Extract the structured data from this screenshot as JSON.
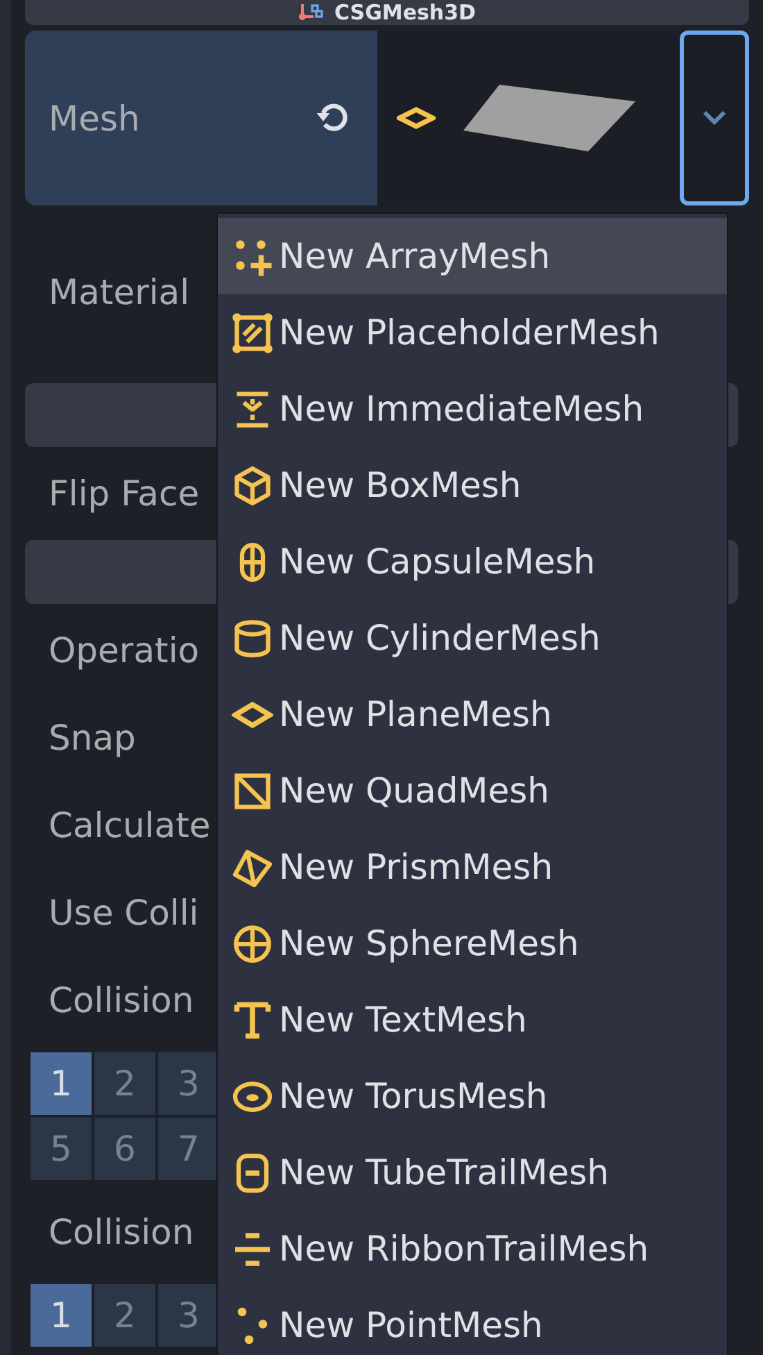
{
  "header": {
    "title": "CSGMesh3D"
  },
  "mesh_row": {
    "label": "Mesh"
  },
  "material_row": {
    "label": "Material"
  },
  "properties": [
    {
      "kind": "section"
    },
    {
      "kind": "label",
      "label": "Flip Face"
    },
    {
      "kind": "section"
    },
    {
      "kind": "label",
      "label": "Operatio"
    },
    {
      "kind": "label",
      "label": "Snap"
    },
    {
      "kind": "label",
      "label": "Calculate"
    },
    {
      "kind": "label",
      "label": "Use Colli"
    },
    {
      "kind": "label",
      "label": "Collision"
    },
    {
      "kind": "grid",
      "cells": [
        {
          "label": "1",
          "selected": true
        },
        {
          "label": "2",
          "selected": false
        },
        {
          "label": "3",
          "selected": false
        },
        {
          "label": "5",
          "selected": false
        },
        {
          "label": "6",
          "selected": false
        },
        {
          "label": "7",
          "selected": false
        }
      ]
    },
    {
      "kind": "label",
      "label": "Collision"
    },
    {
      "kind": "grid",
      "cells": [
        {
          "label": "1",
          "selected": true
        },
        {
          "label": "2",
          "selected": false
        },
        {
          "label": "3",
          "selected": false
        }
      ]
    }
  ],
  "menu": [
    {
      "label": "New ArrayMesh",
      "selected": true
    },
    {
      "label": "New PlaceholderMesh",
      "selected": false
    },
    {
      "label": "New ImmediateMesh",
      "selected": false
    },
    {
      "label": "New BoxMesh",
      "selected": false
    },
    {
      "label": "New CapsuleMesh",
      "selected": false
    },
    {
      "label": "New CylinderMesh",
      "selected": false
    },
    {
      "label": "New PlaneMesh",
      "selected": false
    },
    {
      "label": "New QuadMesh",
      "selected": false
    },
    {
      "label": "New PrismMesh",
      "selected": false
    },
    {
      "label": "New SphereMesh",
      "selected": false
    },
    {
      "label": "New TextMesh",
      "selected": false
    },
    {
      "label": "New TorusMesh",
      "selected": false
    },
    {
      "label": "New TubeTrailMesh",
      "selected": false
    },
    {
      "label": "New RibbonTrailMesh",
      "selected": false
    },
    {
      "label": "New PointMesh",
      "selected": false
    }
  ]
}
